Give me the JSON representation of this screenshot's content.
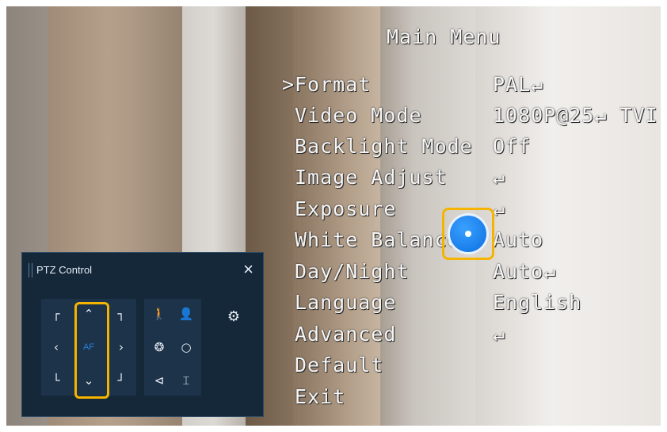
{
  "osd": {
    "title": "Main Menu",
    "selected_marker": ">",
    "items": [
      {
        "label": "Format",
        "value": "PAL↵"
      },
      {
        "label": "Video Mode",
        "value": "1080P@25↵ TVI"
      },
      {
        "label": "Backlight Mode",
        "value": "Off"
      },
      {
        "label": "Image Adjust",
        "value": "↵"
      },
      {
        "label": "Exposure",
        "value": "↵"
      },
      {
        "label": "White Balance",
        "value": "Auto"
      },
      {
        "label": "Day/Night",
        "value": "Auto↵"
      },
      {
        "label": "Language",
        "value": "English"
      },
      {
        "label": "Advanced",
        "value": "↵"
      },
      {
        "label": "Default",
        "value": ""
      },
      {
        "label": "Exit",
        "value": ""
      }
    ]
  },
  "ptz": {
    "title": "PTZ Control",
    "close": "×",
    "focus_label": "AF",
    "glyphs": {
      "up": "⌃",
      "down": "⌄",
      "left": "‹",
      "right": "›",
      "upleft": "┌",
      "upright": "┐",
      "downleft": "└",
      "downright": "┘",
      "person_full": "🚶",
      "person_bust": "👤",
      "iris_open": "❂",
      "iris_close": "○",
      "zoom_out": "⊲",
      "zoom_in": "⌶",
      "gear": "⚙"
    }
  },
  "colors": {
    "highlight": "#f4b400",
    "panel_bg": "#15283a",
    "dpad_blue": "#0b6fe0"
  }
}
